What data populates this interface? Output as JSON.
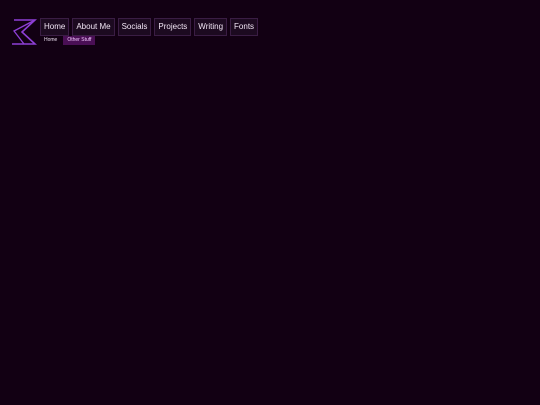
{
  "colors": {
    "background": "#120013",
    "nav_bg": "#1c0a20",
    "nav_border": "#3a1d44",
    "nav_text": "#f2e6f5",
    "logo": "#8e3fd6",
    "subnav_active_bg": "#4a0f55",
    "subnav_active_text": "#f3c6ff"
  },
  "logo": {
    "icon": "sigma-hourglass-logo"
  },
  "nav": {
    "items": [
      {
        "label": "Home"
      },
      {
        "label": "About Me"
      },
      {
        "label": "Socials"
      },
      {
        "label": "Projects"
      },
      {
        "label": "Writing"
      },
      {
        "label": "Fonts"
      }
    ]
  },
  "subnav": {
    "items": [
      {
        "label": "Home",
        "active": false
      },
      {
        "label": "Other Stuff",
        "active": true
      }
    ]
  }
}
